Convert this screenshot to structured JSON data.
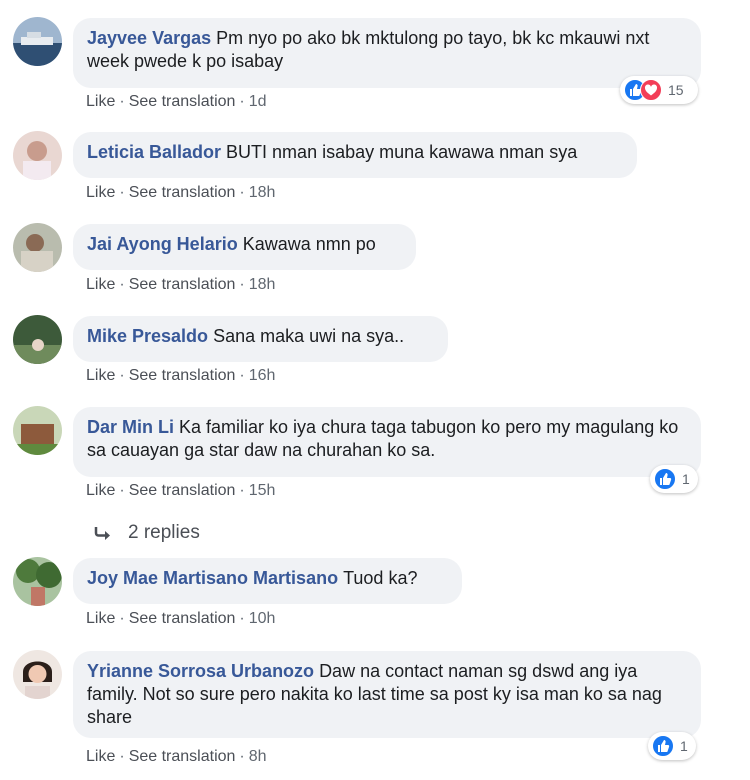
{
  "comments": [
    {
      "name": "Jayvee Vargas",
      "text": "Pm nyo po ako bk mktulong po tayo, bk kc mkauwi nxt week pwede k po isabay",
      "like": "Like",
      "translate": "See translation",
      "time": "1d",
      "reactions": {
        "count": "15",
        "types": [
          "like",
          "love"
        ]
      }
    },
    {
      "name": "Leticia Ballador",
      "text": "BUTI nman isabay muna kawawa nman sya",
      "like": "Like",
      "translate": "See translation",
      "time": "18h"
    },
    {
      "name": "Jai Ayong Helario",
      "text": "Kawawa nmn po",
      "like": "Like",
      "translate": "See translation",
      "time": "18h"
    },
    {
      "name": "Mike Presaldo",
      "text": "Sana maka uwi na sya..",
      "like": "Like",
      "translate": "See translation",
      "time": "16h"
    },
    {
      "name": "Dar Min Li",
      "text": "Ka familiar ko iya chura taga tabugon ko pero my magulang ko sa cauayan ga star daw na churahan ko sa.",
      "like": "Like",
      "translate": "See translation",
      "time": "15h",
      "reactions": {
        "count": "1",
        "types": [
          "like"
        ]
      }
    },
    {
      "name": "Joy Mae Martisano Martisano",
      "text": "Tuod ka?",
      "like": "Like",
      "translate": "See translation",
      "time": "10h"
    },
    {
      "name": "Yrianne Sorrosa Urbanozo",
      "text": "Daw na contact naman sg dswd ang iya family. Not so sure pero nakita ko last time sa post ky isa man ko sa nag share",
      "like": "Like",
      "translate": "See translation",
      "time": "8h",
      "reactions": {
        "count": "1",
        "types": [
          "like"
        ]
      }
    }
  ],
  "replies_link": "2 replies",
  "colors": {
    "name": "#385898",
    "bubble": "#f0f2f5",
    "like": "#1877f2",
    "love": "#f33e58"
  }
}
